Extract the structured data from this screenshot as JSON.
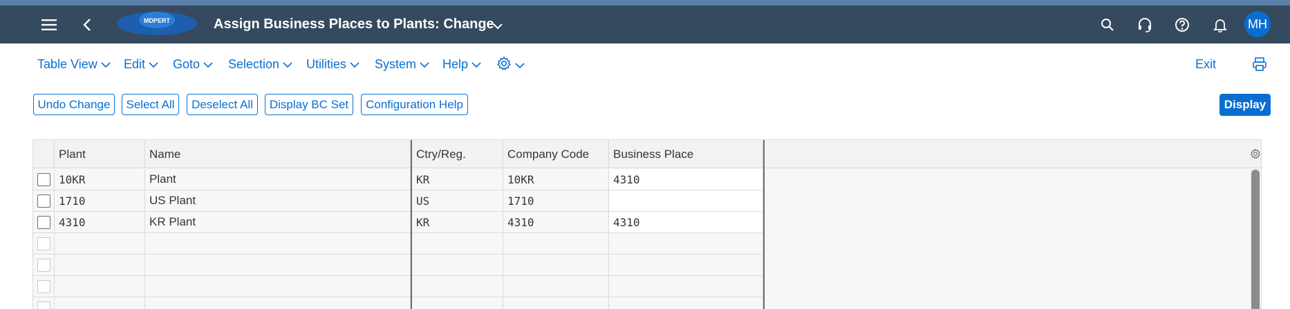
{
  "shell": {
    "logo_text": "MDPERT",
    "title": "Assign Business Places to Plants: Change",
    "avatar_initials": "MH",
    "bar_color": "#354a5f",
    "accent_color": "#0a6ed1"
  },
  "menu": {
    "items": [
      {
        "label": "Table View",
        "icon": "chevron-down-icon"
      },
      {
        "label": "Edit",
        "icon": "chevron-down-icon"
      },
      {
        "label": "Goto",
        "icon": "chevron-down-icon"
      },
      {
        "label": "Selection",
        "icon": "chevron-down-icon"
      },
      {
        "label": "Utilities",
        "icon": "chevron-down-icon"
      },
      {
        "label": "System",
        "icon": "chevron-down-icon"
      },
      {
        "label": "Help",
        "icon": "chevron-down-icon"
      }
    ],
    "settings_icon": "gear-icon",
    "exit_label": "Exit",
    "print_icon": "printer-icon"
  },
  "toolbar": {
    "undo_label": "Undo Change",
    "select_all_label": "Select All",
    "deselect_all_label": "Deselect All",
    "display_bc_set_label": "Display BC Set",
    "config_help_label": "Configuration Help",
    "display_label": "Display"
  },
  "table": {
    "columns": [
      "Plant",
      "Name",
      "Ctry/Reg.",
      "Company Code",
      "Business Place"
    ],
    "rows": [
      {
        "plant": "10KR",
        "name": "Plant",
        "country": "KR",
        "company_code": "10KR",
        "business_place": "4310"
      },
      {
        "plant": "1710",
        "name": "US Plant",
        "country": "US",
        "company_code": "1710",
        "business_place": ""
      },
      {
        "plant": "4310",
        "name": "KR Plant",
        "country": "KR",
        "company_code": "4310",
        "business_place": "4310"
      }
    ]
  }
}
